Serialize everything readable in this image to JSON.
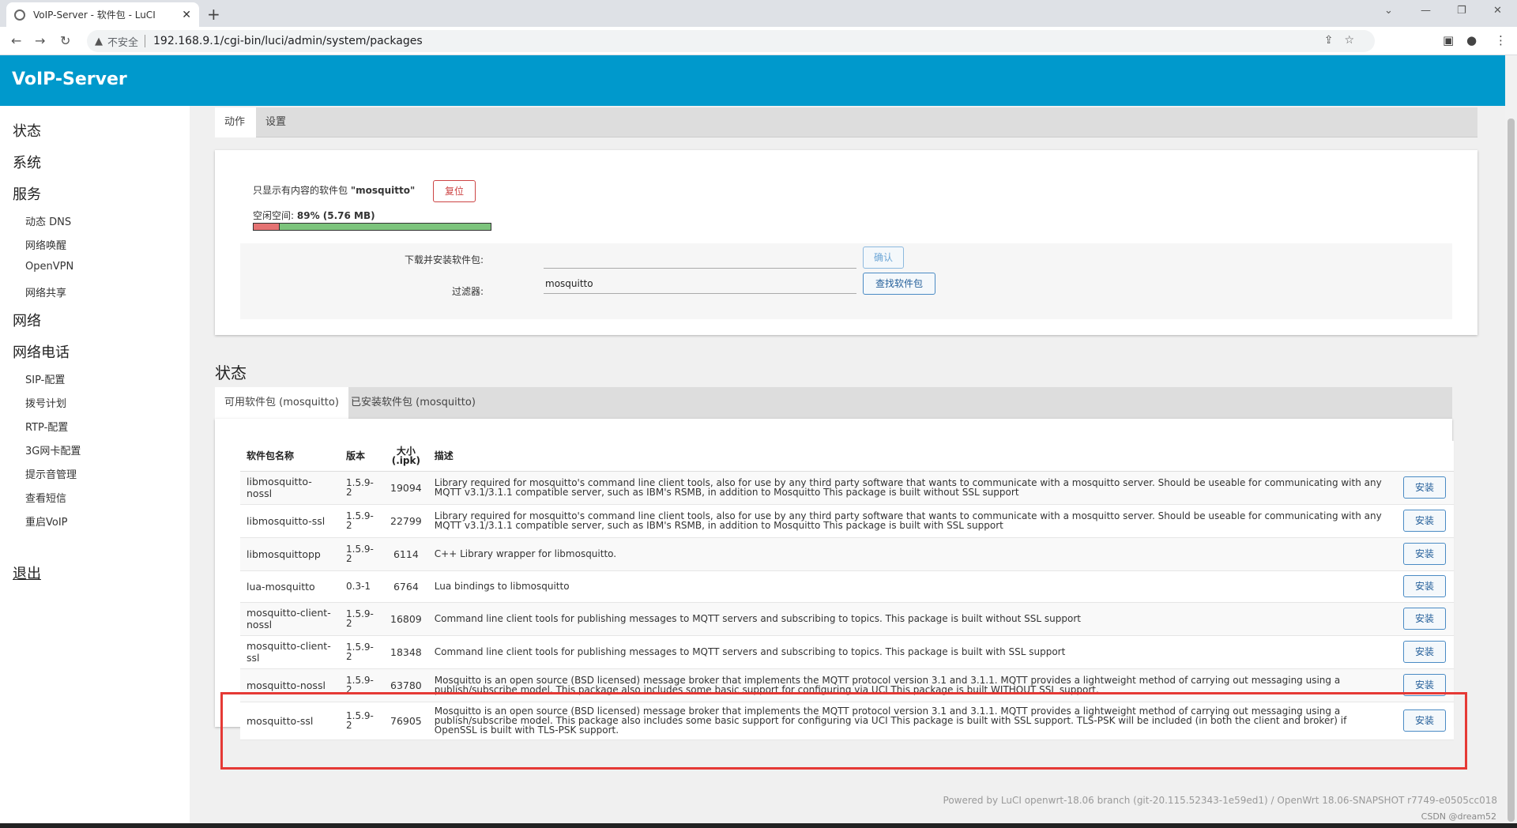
{
  "browser": {
    "tab_title": "VoIP-Server - 软件包 - LuCI",
    "new_tab": "+",
    "insecure_label": "不安全",
    "url": "192.168.9.1/cgi-bin/luci/admin/system/packages"
  },
  "header": {
    "brand": "VoIP-Server"
  },
  "sidebar": {
    "sections": [
      {
        "label": "状态"
      },
      {
        "label": "系统"
      },
      {
        "label": "服务"
      },
      {
        "label": "网络"
      },
      {
        "label": "网络电话"
      }
    ],
    "services_items": [
      "动态 DNS",
      "网络唤醒",
      "OpenVPN",
      "网络共享"
    ],
    "voip_items": [
      "SIP-配置",
      "拨号计划",
      "RTP-配置",
      "3G网卡配置",
      "提示音管理",
      "查看短信",
      "重启VoIP"
    ],
    "logout": "退出"
  },
  "top_tabs": {
    "actions": "动作",
    "config": "设置"
  },
  "actions": {
    "filter_notice_prefix": "只显示有内容的软件包",
    "filter_notice_value": "\"mosquitto\"",
    "reset_button": "复位",
    "free_space_label": "空闲空间:",
    "free_space_value": "89% (5.76 MB)",
    "free_fraction": 0.89,
    "download_label": "下载并安装软件包:",
    "download_value": "",
    "confirm_button": "确认",
    "filter_label": "过滤器:",
    "filter_value": "mosquitto",
    "find_button": "查找软件包"
  },
  "status": {
    "title": "状态",
    "tab_available": "可用软件包 (mosquitto)",
    "tab_installed": "已安装软件包 (mosquitto)",
    "columns": [
      "软件包名称",
      "版本",
      "大小\n(.ipk)",
      "描述"
    ],
    "install_label": "安装",
    "packages": [
      {
        "name": "libmosquitto-nossl",
        "version": "1.5.9-2",
        "size": "19094",
        "desc": "Library required for mosquitto's command line client tools, also for use by any third party software that wants to communicate with a mosquitto server. Should be useable for communicating with any MQTT v3.1/3.1.1 compatible server, such as IBM's RSMB, in addition to Mosquitto This package is built without SSL support"
      },
      {
        "name": "libmosquitto-ssl",
        "version": "1.5.9-2",
        "size": "22799",
        "desc": "Library required for mosquitto's command line client tools, also for use by any third party software that wants to communicate with a mosquitto server. Should be useable for communicating with any MQTT v3.1/3.1.1 compatible server, such as IBM's RSMB, in addition to Mosquitto This package is built with SSL support"
      },
      {
        "name": "libmosquittopp",
        "version": "1.5.9-2",
        "size": "6114",
        "desc": "C++ Library wrapper for libmosquitto."
      },
      {
        "name": "lua-mosquitto",
        "version": "0.3-1",
        "size": "6764",
        "desc": "Lua bindings to libmosquitto"
      },
      {
        "name": "mosquitto-client-nossl",
        "version": "1.5.9-2",
        "size": "16809",
        "desc": "Command line client tools for publishing messages to MQTT servers and subscribing to topics. This package is built without SSL support"
      },
      {
        "name": "mosquitto-client-ssl",
        "version": "1.5.9-2",
        "size": "18348",
        "desc": "Command line client tools for publishing messages to MQTT servers and subscribing to topics. This package is built with SSL support"
      },
      {
        "name": "mosquitto-nossl",
        "version": "1.5.9-2",
        "size": "63780",
        "desc": "Mosquitto is an open source (BSD licensed) message broker that implements the MQTT protocol version 3.1 and 3.1.1. MQTT provides a lightweight method of carrying out messaging using a publish/subscribe model. This package also includes some basic support for configuring via UCI This package is built WITHOUT SSL support."
      },
      {
        "name": "mosquitto-ssl",
        "version": "1.5.9-2",
        "size": "76905",
        "desc": "Mosquitto is an open source (BSD licensed) message broker that implements the MQTT protocol version 3.1 and 3.1.1. MQTT provides a lightweight method of carrying out messaging using a publish/subscribe model. This package also includes some basic support for configuring via UCI This package is built with SSL support. TLS-PSK will be included (in both the client and broker) if OpenSSL is built with TLS-PSK support."
      }
    ]
  },
  "footer": {
    "powered": "Powered by LuCI openwrt-18.06 branch (git-20.115.52343-1e59ed1) / OpenWrt 18.06-SNAPSHOT r7749-e0505cc018",
    "watermark": "CSDN @dream52"
  },
  "colors": {
    "header_bg": "#0099cc",
    "highlight": "#e53935",
    "free_bar": "#7cc47c",
    "used_bar": "#e57373"
  }
}
